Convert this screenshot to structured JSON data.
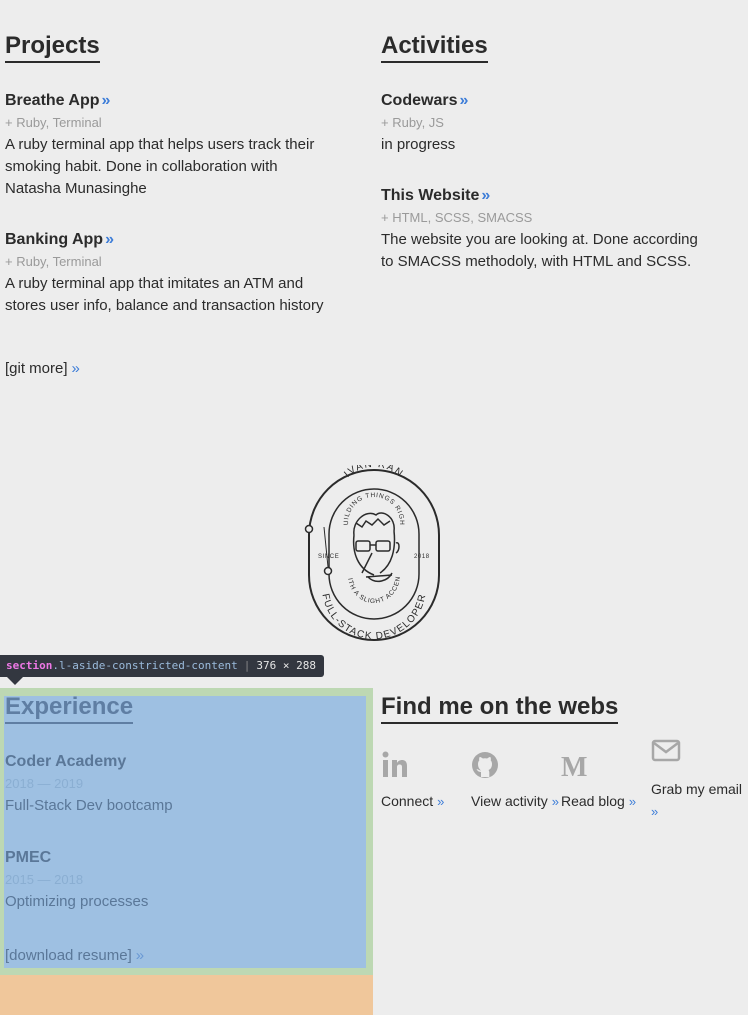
{
  "projects": {
    "title": "Projects",
    "items": [
      {
        "title": "Breathe App",
        "tags": "+ Ruby, Terminal",
        "desc": "A ruby terminal app that helps users track their smoking habit. Done in collaboration with Natasha Munasinghe"
      },
      {
        "title": "Banking App",
        "tags": "+ Ruby, Terminal",
        "desc": "A ruby terminal app that imitates an ATM and stores user info, balance and transaction history"
      }
    ],
    "more_link": "[git more]"
  },
  "activities": {
    "title": "Activities",
    "items": [
      {
        "title": "Codewars",
        "tags": "+ Ruby, JS",
        "desc": "in progress"
      },
      {
        "title": "This Website",
        "tags": "+ HTML, SCSS, SMACSS",
        "desc": "The website you are looking at. Done according to SMACSS methodoly, with HTML and SCSS."
      }
    ]
  },
  "logo": {
    "name": "IVAN RAN",
    "tagline_top": "BUILDING THINGS RIGHT",
    "since_label": "SINCE",
    "year": "2018",
    "tagline_bottom": "WITH A SLIGHT ACCENT",
    "role": "FULL-STACK DEVELOPER"
  },
  "devtools": {
    "tag": "section",
    "class_name": ".l-aside-constricted-content",
    "dims": "376 × 288"
  },
  "experience": {
    "title": "Experience",
    "items": [
      {
        "title": "Coder Academy",
        "dates": "2018 — 2019",
        "desc": "Full-Stack Dev bootcamp"
      },
      {
        "title": "PMEC",
        "dates": "2015 — 2018",
        "desc": "Optimizing processes"
      }
    ],
    "download_link": "[download resume]"
  },
  "webs": {
    "title": "Find me on the webs",
    "links": [
      {
        "icon": "linkedin-icon",
        "label": "Connect"
      },
      {
        "icon": "github-icon",
        "label": "View activity"
      },
      {
        "icon": "medium-icon",
        "label": "Read blog"
      },
      {
        "icon": "email-icon",
        "label": "Grab my email"
      }
    ]
  },
  "raquo": "»",
  "colors": {
    "link_accent": "#3d7dd8",
    "highlight_content": "#9ec0e2",
    "highlight_padding": "#bdd8b3",
    "highlight_margin": "#f0c79b",
    "tooltip_bg": "#333740"
  }
}
